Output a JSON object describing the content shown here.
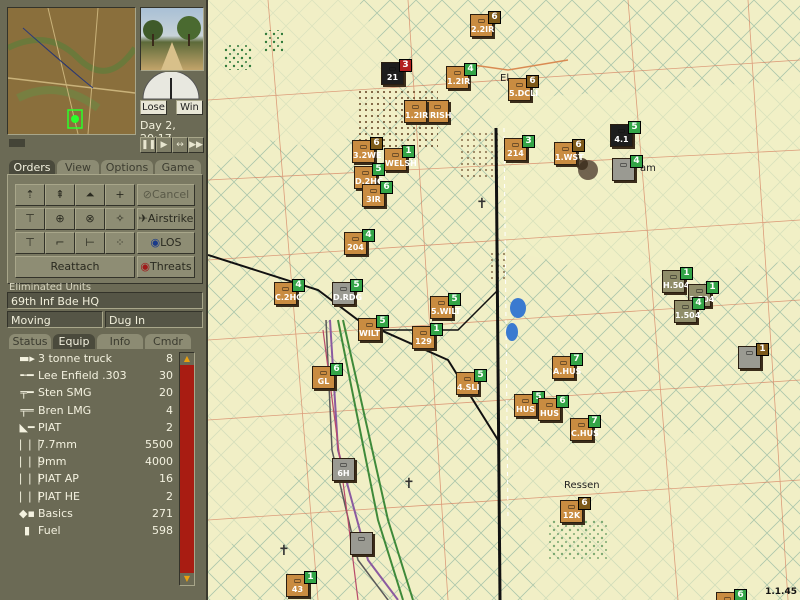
{
  "panel": {
    "dial": {
      "lose_label": "Lose",
      "win_label": "Win"
    },
    "clock": "Day 2, 20:17",
    "tabs": [
      "Orders",
      "View",
      "Options",
      "Game"
    ],
    "orders": {
      "cancel_label": "Cancel",
      "airstrike_label": "Airstrike",
      "los_label": "LOS",
      "threats_label": "Threats",
      "reattach_label": "Reattach"
    },
    "eliminated_label": "Eliminated Units",
    "unit_name": "69th Inf Bde HQ",
    "status_left": "Moving",
    "status_right": "Dug In",
    "sub_tabs": [
      "Status",
      "Equip",
      "Info",
      "Cmdr"
    ],
    "equipment": [
      {
        "icon": "truck-icon",
        "name": "3 tonne truck",
        "qty": "8"
      },
      {
        "icon": "rifle-icon",
        "name": "Lee Enfield .303",
        "qty": "30"
      },
      {
        "icon": "smg-icon",
        "name": "Sten SMG",
        "qty": "20"
      },
      {
        "icon": "lmg-icon",
        "name": "Bren LMG",
        "qty": "4"
      },
      {
        "icon": "piat-icon",
        "name": "PIAT",
        "qty": "2"
      },
      {
        "icon": "ammo-icon",
        "name": "7.7mm",
        "qty": "5500"
      },
      {
        "icon": "ammo-icon",
        "name": "9mm",
        "qty": "4000"
      },
      {
        "icon": "ammo-icon",
        "name": "PIAT AP",
        "qty": "16"
      },
      {
        "icon": "ammo-icon",
        "name": "PIAT HE",
        "qty": "2"
      },
      {
        "icon": "basics-icon",
        "name": "Basics",
        "qty": "271"
      },
      {
        "icon": "fuel-icon",
        "name": "Fuel",
        "qty": "598"
      }
    ]
  },
  "map": {
    "place_labels": [
      "Ressen",
      "am",
      "El"
    ],
    "units": [
      {
        "label": "2.2IR",
        "num": "6",
        "style": "tan",
        "numcolor": "ndark"
      },
      {
        "label": "21",
        "num": "3",
        "style": "black",
        "numcolor": "nred"
      },
      {
        "label": "1.2IR",
        "num": "4",
        "style": "tan",
        "numcolor": "ngreen"
      },
      {
        "label": "5.DCLI",
        "num": "6",
        "style": "tan",
        "numcolor": "ndark"
      },
      {
        "label": "IRISH",
        "num": "",
        "style": "tan",
        "numcolor": "ngreen"
      },
      {
        "label": "1.2IR",
        "num": "",
        "style": "tan",
        "numcolor": "ngreen"
      },
      {
        "label": "3.2WE",
        "num": "6",
        "style": "tan",
        "numcolor": "ndark"
      },
      {
        "label": "WELSH",
        "num": "1",
        "style": "tan",
        "numcolor": "ngreen"
      },
      {
        "label": "D.2HC",
        "num": "5",
        "style": "tan",
        "numcolor": "ngreen"
      },
      {
        "label": "3IR",
        "num": "6",
        "style": "tan",
        "numcolor": "ngreen"
      },
      {
        "label": "214",
        "num": "3",
        "style": "tan",
        "numcolor": "ngreen"
      },
      {
        "label": "1.WST",
        "num": "6",
        "style": "tan",
        "numcolor": "ndark"
      },
      {
        "label": "4.1",
        "num": "5",
        "style": "black",
        "numcolor": "ngreen"
      },
      {
        "label": "",
        "num": "4",
        "style": "grey",
        "numcolor": "ngreen"
      },
      {
        "label": "204",
        "num": "4",
        "style": "tan",
        "numcolor": "ngreen"
      },
      {
        "label": "C.2HC",
        "num": "4",
        "style": "tan",
        "numcolor": "ngreen"
      },
      {
        "label": "D.RDG",
        "num": "5",
        "style": "grey",
        "numcolor": "ngreen"
      },
      {
        "label": "WILT",
        "num": "5",
        "style": "tan",
        "numcolor": "ngreen"
      },
      {
        "label": "5.WILT",
        "num": "5",
        "style": "tan",
        "numcolor": "ngreen"
      },
      {
        "label": "129",
        "num": "1",
        "style": "tan",
        "numcolor": "ngreen"
      },
      {
        "label": "GL",
        "num": "6",
        "style": "tan",
        "numcolor": "ngreen"
      },
      {
        "label": "4.SLI",
        "num": "5",
        "style": "tan",
        "numcolor": "ngreen"
      },
      {
        "label": "A.HUS",
        "num": "7",
        "style": "tan",
        "numcolor": "ngreen"
      },
      {
        "label": "HUS",
        "num": "5",
        "style": "tan",
        "numcolor": "ngreen"
      },
      {
        "label": "HUS",
        "num": "6",
        "style": "tan",
        "numcolor": "ngreen"
      },
      {
        "label": "C.HUS",
        "num": "7",
        "style": "tan",
        "numcolor": "ngreen"
      },
      {
        "label": "H.504",
        "num": "1",
        "style": "khaki",
        "numcolor": "ngreen"
      },
      {
        "label": "3.504",
        "num": "1",
        "style": "khaki",
        "numcolor": "ngreen"
      },
      {
        "label": "1.504",
        "num": "4",
        "style": "khaki",
        "numcolor": "ngreen"
      },
      {
        "label": "",
        "num": "1",
        "style": "grey",
        "numcolor": "ndark"
      },
      {
        "label": "6H",
        "num": "",
        "style": "grey",
        "numcolor": "ngreen"
      },
      {
        "label": "12K",
        "num": "6",
        "style": "tan",
        "numcolor": "ndark"
      },
      {
        "label": "",
        "num": "",
        "style": "grey",
        "numcolor": "ngreen"
      },
      {
        "label": "43",
        "num": "1",
        "style": "tan",
        "numcolor": "ngreen"
      },
      {
        "label": "",
        "num": "6",
        "style": "tan",
        "numcolor": "ngreen"
      }
    ],
    "version": "1.1.45"
  }
}
